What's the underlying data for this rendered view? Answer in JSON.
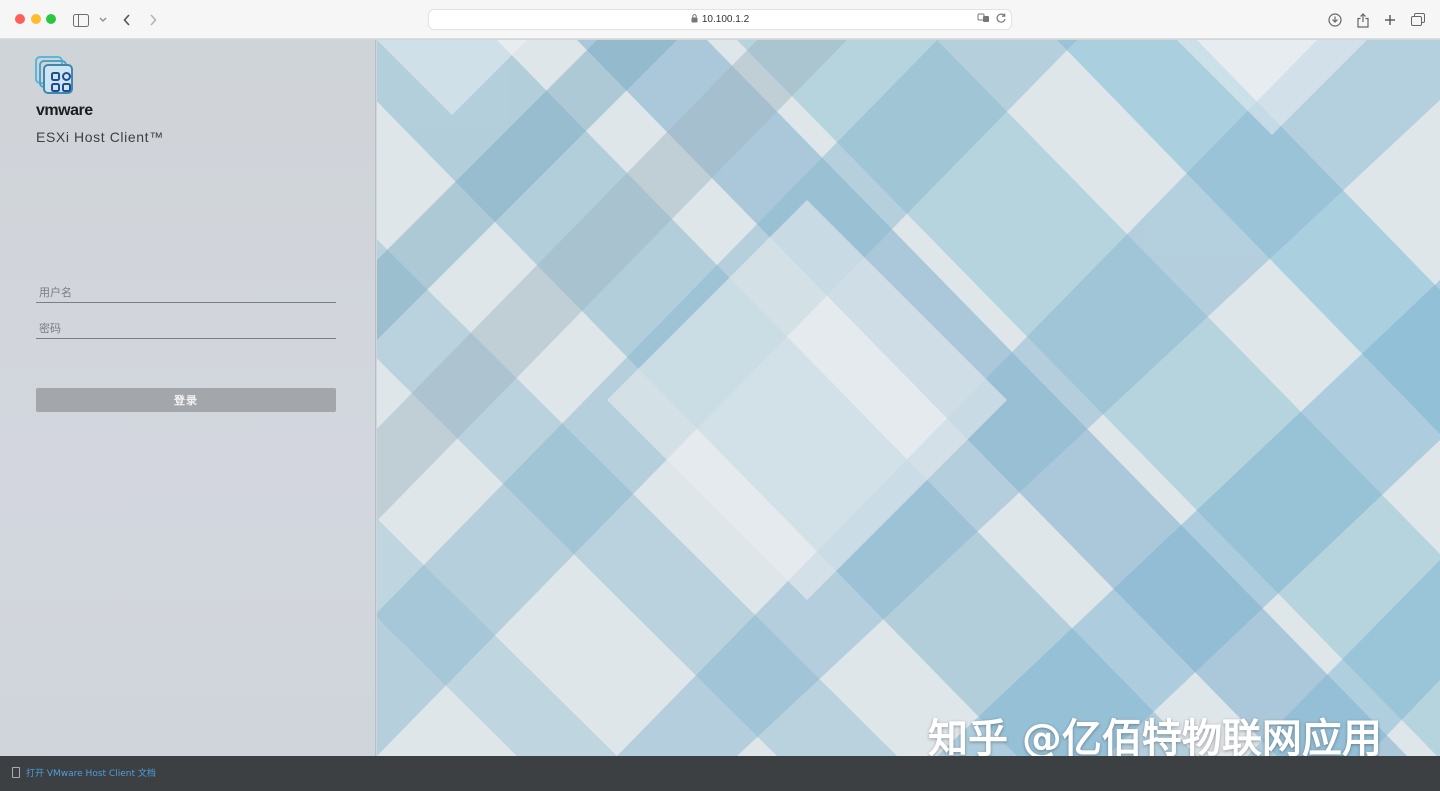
{
  "browser": {
    "url": "10.100.1.2"
  },
  "app": {
    "brand": "vmware",
    "product": "ESXi Host Client™"
  },
  "login": {
    "username_placeholder": "用户名",
    "password_placeholder": "密码",
    "button_label": "登录"
  },
  "footer": {
    "doc_link": "打开 VMware Host Client 文档"
  },
  "watermark": "知乎 @亿佰特物联网应用",
  "colors": {
    "login_button": "#a3a7ab",
    "footer_bg": "#3c4043",
    "link": "#4d9fe0",
    "left_panel": "#cfd4d8"
  }
}
